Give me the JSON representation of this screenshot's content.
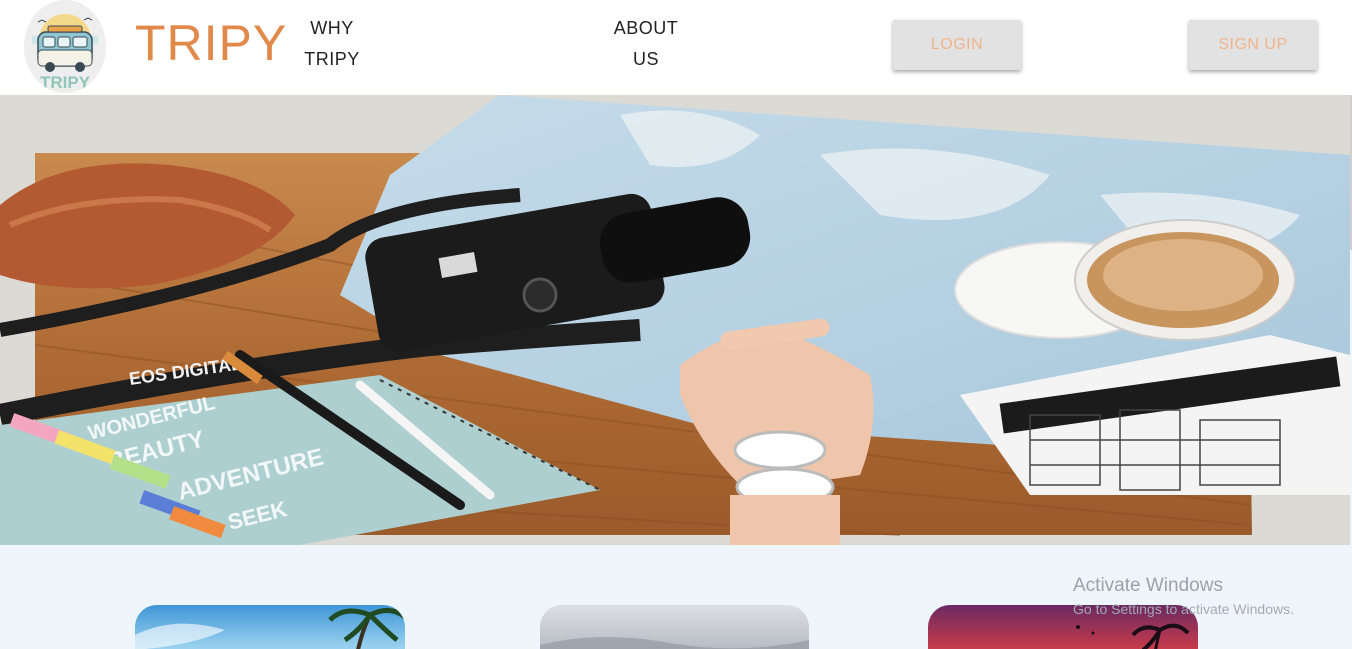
{
  "navbar": {
    "logo_text": "TRIPY",
    "brand": "TRIPY",
    "links": [
      {
        "line1": "WHY",
        "line2": "TRIPY"
      },
      {
        "line1": "ABOUT",
        "line2": "US"
      }
    ],
    "login_label": "LOGIN",
    "signup_label": "SIGN UP"
  },
  "hero": {
    "camera_label": "EOS DIGITAL",
    "notebook_lines": [
      "WONDERFUL",
      "BEAUTY",
      "ADVENTURE",
      "SEEK"
    ]
  },
  "colors": {
    "brand": "#e0894b",
    "button_bg": "#e2e2e2",
    "button_text": "#f0b48c",
    "section_bg": "#eef6fc"
  },
  "watermark": {
    "title": "Activate Windows",
    "subtitle": "Go to Settings to activate Windows."
  }
}
